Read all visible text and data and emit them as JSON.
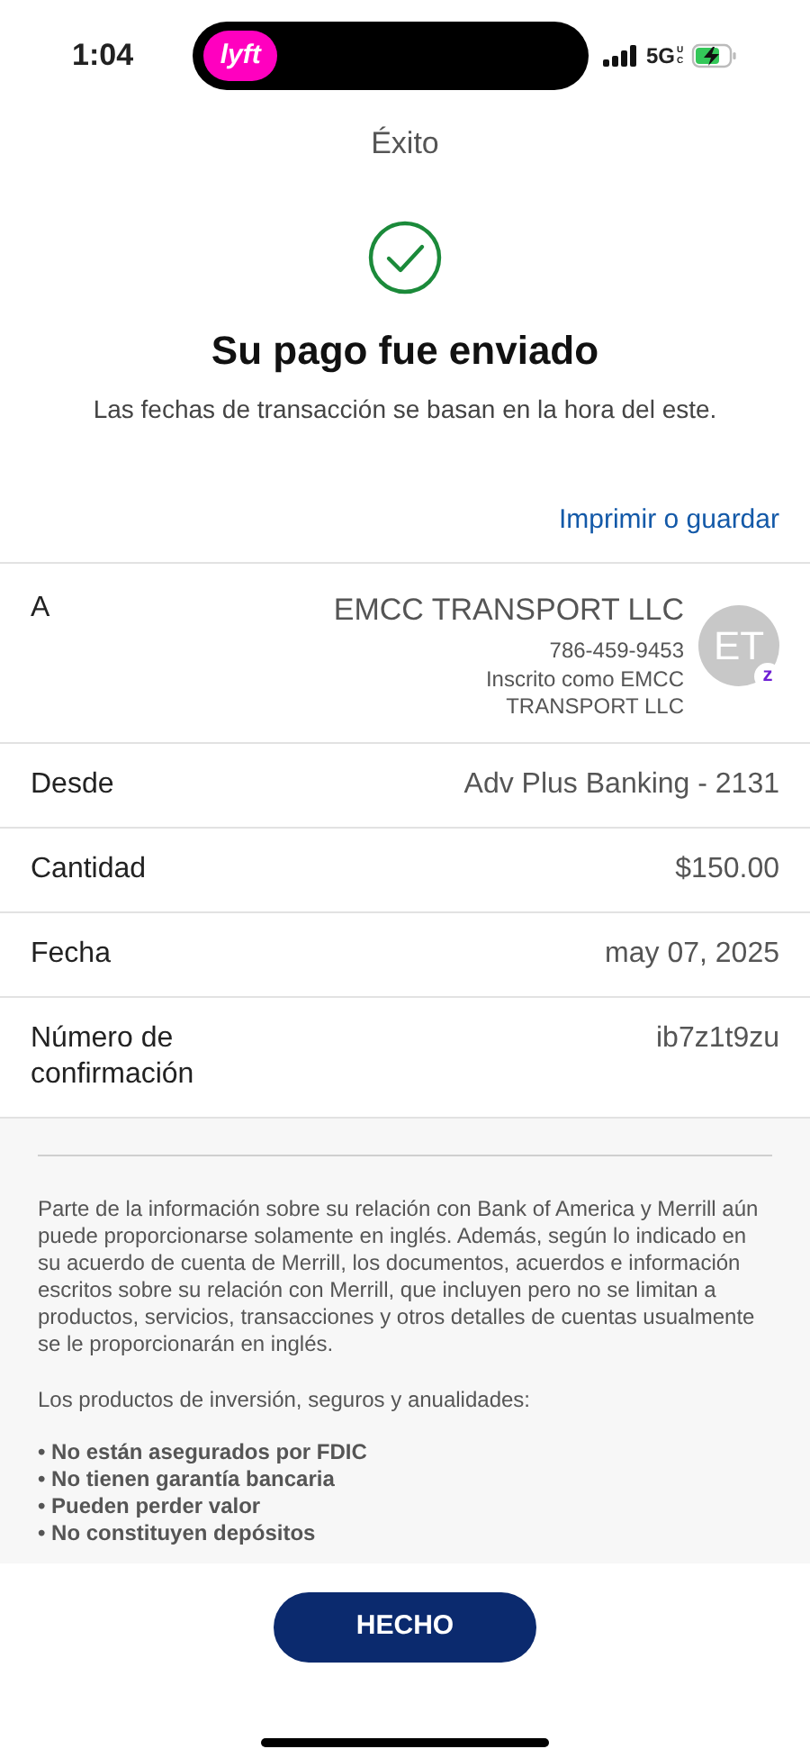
{
  "status_bar": {
    "time": "1:04",
    "app_badge": "lyft",
    "network": "5G",
    "network_suffix": "UC",
    "charging": true
  },
  "header": {
    "title": "Éxito"
  },
  "confirmation": {
    "title": "Su pago fue enviado",
    "subtitle": "Las fechas de transacción se basan en la hora del este.",
    "print_link": "Imprimir o guardar"
  },
  "recipient": {
    "label": "A",
    "name": "EMCC TRANSPORT LLC",
    "phone": "786-459-9453",
    "enrolled_as": "Inscrito como EMCC TRANSPORT LLC",
    "initials": "ET",
    "badge": "z"
  },
  "details": [
    {
      "label": "Desde",
      "value": "Adv Plus Banking - 2131"
    },
    {
      "label": "Cantidad",
      "value": "$150.00"
    },
    {
      "label": "Fecha",
      "value": "may 07, 2025"
    },
    {
      "label": "Número de confirmación",
      "value": "ib7z1t9zu"
    }
  ],
  "disclaimer": {
    "paragraph": "Parte de la información sobre su relación con Bank of America y Merrill aún puede proporcionarse solamente en inglés. Además, según lo indicado en su acuerdo de cuenta de Merrill, los documentos, acuerdos e información escritos sobre su relación con Merrill, que incluyen pero no se limitan a productos, servicios, transacciones y otros detalles de cuentas usualmente se le proporcionarán en inglés.",
    "intro": "Los productos de inversión, seguros y anualidades:",
    "bullets": [
      "• No están asegurados por FDIC",
      "• No tienen garantía bancaria",
      "• Pueden perder valor",
      "• No constituyen depósitos"
    ]
  },
  "done_button": "HECHO"
}
